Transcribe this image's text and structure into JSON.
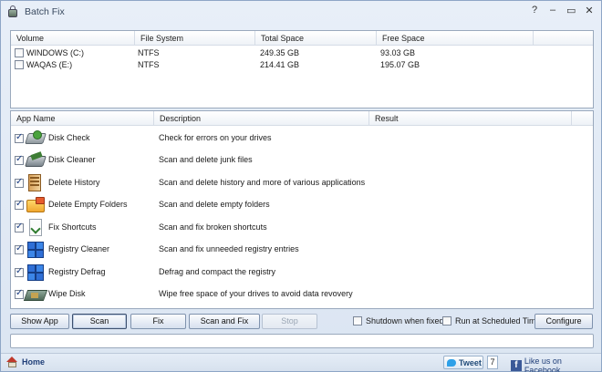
{
  "window": {
    "title": "Batch Fix",
    "controls": {
      "help": "?",
      "minimize": "–",
      "maximize": "▭",
      "close": "✕"
    }
  },
  "volumes": {
    "headers": [
      "Volume",
      "File System",
      "Total Space",
      "Free Space"
    ],
    "rows": [
      {
        "checked": false,
        "volume": "WINDOWS (C:)",
        "fs": "NTFS",
        "total": "249.35 GB",
        "free": "93.03 GB"
      },
      {
        "checked": false,
        "volume": "WAQAS (E:)",
        "fs": "NTFS",
        "total": "214.41 GB",
        "free": "195.07 GB"
      }
    ]
  },
  "apps": {
    "headers": [
      "App Name",
      "Description",
      "Result"
    ],
    "rows": [
      {
        "checked": true,
        "icon": "disk-check-icon",
        "name": "Disk Check",
        "desc": "Check for errors on your drives",
        "result": ""
      },
      {
        "checked": true,
        "icon": "disk-cleaner-icon",
        "name": "Disk Cleaner",
        "desc": "Scan and delete junk files",
        "result": ""
      },
      {
        "checked": true,
        "icon": "history-icon",
        "name": "Delete History",
        "desc": "Scan and delete history and more of various applications",
        "result": ""
      },
      {
        "checked": true,
        "icon": "folder-icon",
        "name": "Delete Empty Folders",
        "desc": "Scan and delete empty folders",
        "result": ""
      },
      {
        "checked": true,
        "icon": "shortcut-icon",
        "name": "Fix Shortcuts",
        "desc": "Scan and fix broken shortcuts",
        "result": ""
      },
      {
        "checked": true,
        "icon": "registry-icon",
        "name": "Registry Cleaner",
        "desc": "Scan and fix unneeded registry entries",
        "result": ""
      },
      {
        "checked": true,
        "icon": "registry-defrag-icon",
        "name": "Registry Defrag",
        "desc": "Defrag and compact the registry",
        "result": ""
      },
      {
        "checked": true,
        "icon": "wipe-disk-icon",
        "name": "Wipe Disk",
        "desc": "Wipe free space of your drives to avoid data revovery",
        "result": ""
      }
    ]
  },
  "toolbar": {
    "show_app": "Show App",
    "scan": "Scan",
    "fix": "Fix",
    "scan_and_fix": "Scan and Fix",
    "stop": "Stop",
    "shutdown_label": "Shutdown when fixed",
    "shutdown_checked": false,
    "scheduled_label": "Run at Scheduled Time",
    "scheduled_checked": false,
    "configure": "Configure"
  },
  "status": {
    "text": ""
  },
  "footer": {
    "home": "Home",
    "tweet": "Tweet",
    "tweet_count": "7",
    "facebook": "Like us on Facebook."
  }
}
